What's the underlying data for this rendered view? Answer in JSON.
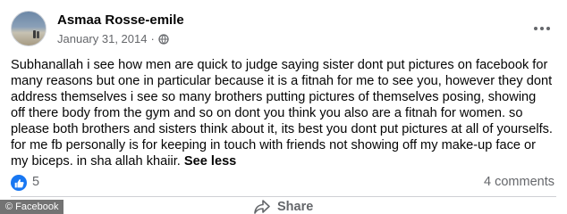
{
  "post": {
    "author": "Asmaa Rosse-emile",
    "date": "January 31, 2014",
    "separator": "·",
    "audience_icon": "globe-icon",
    "text": "Subhanallah i see how men are quick to judge saying sister dont put pictures on facebook for many reasons but one in particular because it is a fitnah for me to see you, however they dont address themselves i see so many brothers putting pictures of themselves posing, showing off there body from the gym and so on dont you think you also are a fitnah for women. so please both brothers and sisters think about it, its best you dont put pictures at all of yourselfs. for me fb personally is for keeping in touch with friends not showing off my make-up face or my biceps. in sha allah khaiir.",
    "see_less": "See less"
  },
  "reactions": {
    "like_count": "5",
    "comments": "4 comments"
  },
  "actions": {
    "share_label": "Share"
  },
  "watermark": "© Facebook",
  "colors": {
    "accent": "#1877f2",
    "secondary_text": "#65676b",
    "divider": "#ced0d4"
  }
}
